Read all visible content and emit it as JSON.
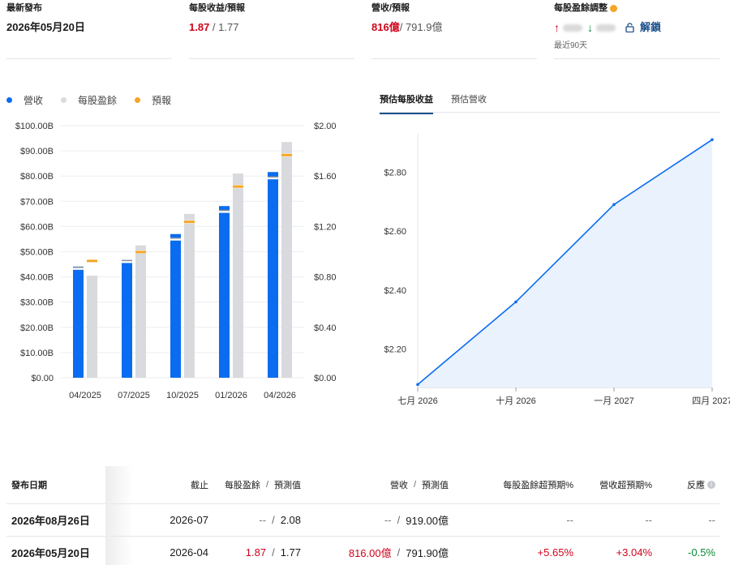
{
  "stats": {
    "latest": {
      "label": "最新發布",
      "value": "2026年05月20日"
    },
    "eps": {
      "label": "每股收益/預報",
      "actual": "1.87",
      "sep": " / ",
      "forecast": "1.77"
    },
    "revenue": {
      "label": "營收/預報",
      "actual": "816億",
      "sep": "/ ",
      "forecast": "791.9億"
    },
    "revision": {
      "label": "每股盈餘調整",
      "up_icon": "arrow-up-icon",
      "down_icon": "arrow-down-icon",
      "unlock": "解鎖",
      "period": "最近90天"
    }
  },
  "legend": {
    "revenue": "營收",
    "eps": "每股盈餘",
    "forecast": "預報"
  },
  "tabs": [
    "預估每股收益",
    "預估營收"
  ],
  "chart_data": [
    {
      "type": "bar",
      "categories": [
        "04/2025",
        "07/2025",
        "10/2025",
        "01/2026",
        "04/2026"
      ],
      "left_axis_ticks": [
        "$100.00B",
        "$90.00B",
        "$80.00B",
        "$70.00B",
        "$60.00B",
        "$50.00B",
        "$40.00B",
        "$30.00B",
        "$20.00B",
        "$10.00B",
        "$0.00"
      ],
      "right_axis_ticks": [
        "$2.00",
        "$1.60",
        "$1.20",
        "$0.80",
        "$0.40",
        "$0.00"
      ],
      "ylim_left": [
        0,
        100
      ],
      "ylim_right": [
        0,
        2
      ],
      "series": [
        {
          "name": "營收",
          "axis": "left",
          "color": "#0a6cf0",
          "values": [
            44.1,
            46.7,
            57.0,
            68.1,
            81.6
          ],
          "forecast": [
            43.3,
            46.0,
            54.9,
            65.9,
            79.2
          ]
        },
        {
          "name": "每股盈餘",
          "axis": "right",
          "color": "#d8dadd",
          "values": [
            0.81,
            1.05,
            1.3,
            1.62,
            1.87
          ],
          "forecast": [
            0.93,
            1.0,
            1.24,
            1.52,
            1.77
          ]
        }
      ],
      "forecast_color": "#f5a623",
      "grid": true
    },
    {
      "type": "area",
      "categories": [
        "七月 2026",
        "十月 2026",
        "一月 2027",
        "四月 2027"
      ],
      "y_ticks": [
        "$2.80",
        "$2.60",
        "$2.40",
        "$2.20"
      ],
      "ylim": [
        2.07,
        2.93
      ],
      "values": [
        2.08,
        2.36,
        2.69,
        2.91
      ],
      "color": "#0a6cf0",
      "fill": "#eaf2fd"
    }
  ],
  "table": {
    "headers": {
      "date": "發布日期",
      "end": "截止",
      "eps": "每股盈餘",
      "eps_fc": "預測值",
      "rev": "營收",
      "rev_fc": "預測值",
      "eps_surprise": "每股盈餘超預期%",
      "rev_surprise": "營收超預期%",
      "reaction": "反應"
    },
    "rows": [
      {
        "date": "2026年08月26日",
        "end": "2026-07",
        "eps": "--",
        "eps_fc": "2.08",
        "rev": "--",
        "rev_fc": "919.00億",
        "eps_surprise": "--",
        "rev_surprise": "--",
        "reaction": "--"
      },
      {
        "date": "2026年05月20日",
        "end": "2026-04",
        "eps": "1.87",
        "eps_fc": "1.77",
        "rev": "816.00億",
        "rev_fc": "791.90億",
        "eps_surprise": "+5.65%",
        "rev_surprise": "+3.04%",
        "reaction": "-0.5%"
      }
    ]
  }
}
